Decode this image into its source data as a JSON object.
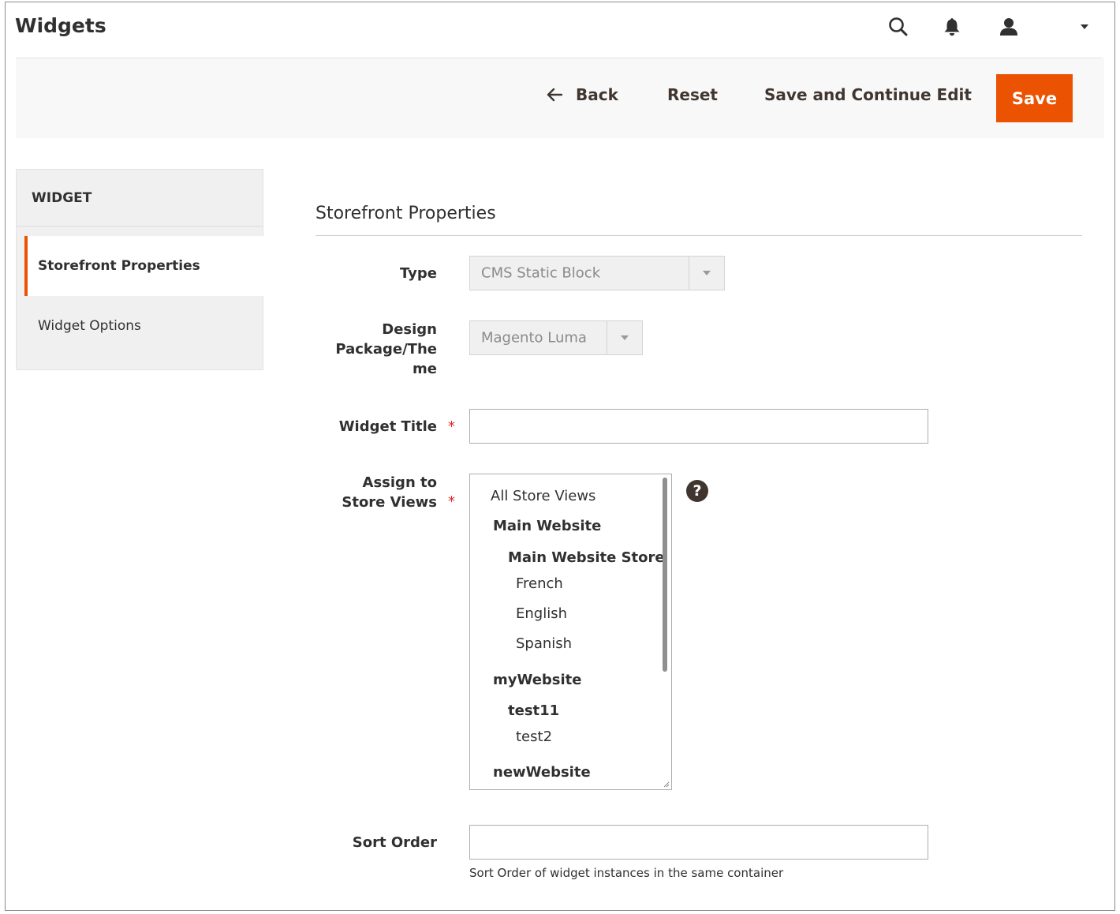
{
  "header": {
    "title": "Widgets",
    "icons": [
      "search-icon",
      "bell-icon",
      "user-icon",
      "caret-down-icon"
    ]
  },
  "actions": {
    "back": "Back",
    "reset": "Reset",
    "save_continue": "Save and Continue Edit",
    "save": "Save"
  },
  "tabs": {
    "heading": "WIDGET",
    "items": [
      {
        "label": "Storefront Properties",
        "active": true
      },
      {
        "label": "Widget Options",
        "active": false
      }
    ]
  },
  "section": {
    "title": "Storefront Properties"
  },
  "form": {
    "type": {
      "label": "Type",
      "value": "CMS Static Block"
    },
    "theme": {
      "label_lines": [
        "Design",
        "Package/The",
        "me"
      ],
      "value": "Magento Luma"
    },
    "widget_title": {
      "label": "Widget Title",
      "required": "*",
      "value": ""
    },
    "store_views": {
      "label_lines": [
        "Assign to",
        "Store Views"
      ],
      "required": "*",
      "options": [
        {
          "label": "All Store Views",
          "kind": "option"
        },
        {
          "label": "Main Website",
          "kind": "website"
        },
        {
          "label": "Main Website Store",
          "kind": "store"
        },
        {
          "label": "French",
          "kind": "view"
        },
        {
          "label": "English",
          "kind": "view"
        },
        {
          "label": "Spanish",
          "kind": "view"
        },
        {
          "label": "myWebsite",
          "kind": "website"
        },
        {
          "label": "test11",
          "kind": "store"
        },
        {
          "label": "test2",
          "kind": "view"
        },
        {
          "label": "newWebsite",
          "kind": "website"
        }
      ],
      "help": "?"
    },
    "sort_order": {
      "label": "Sort Order",
      "value": "",
      "note": "Sort Order of widget instances in the same container"
    }
  },
  "colors": {
    "accent": "#eb5202",
    "required": "#e22626",
    "text": "#303030"
  }
}
